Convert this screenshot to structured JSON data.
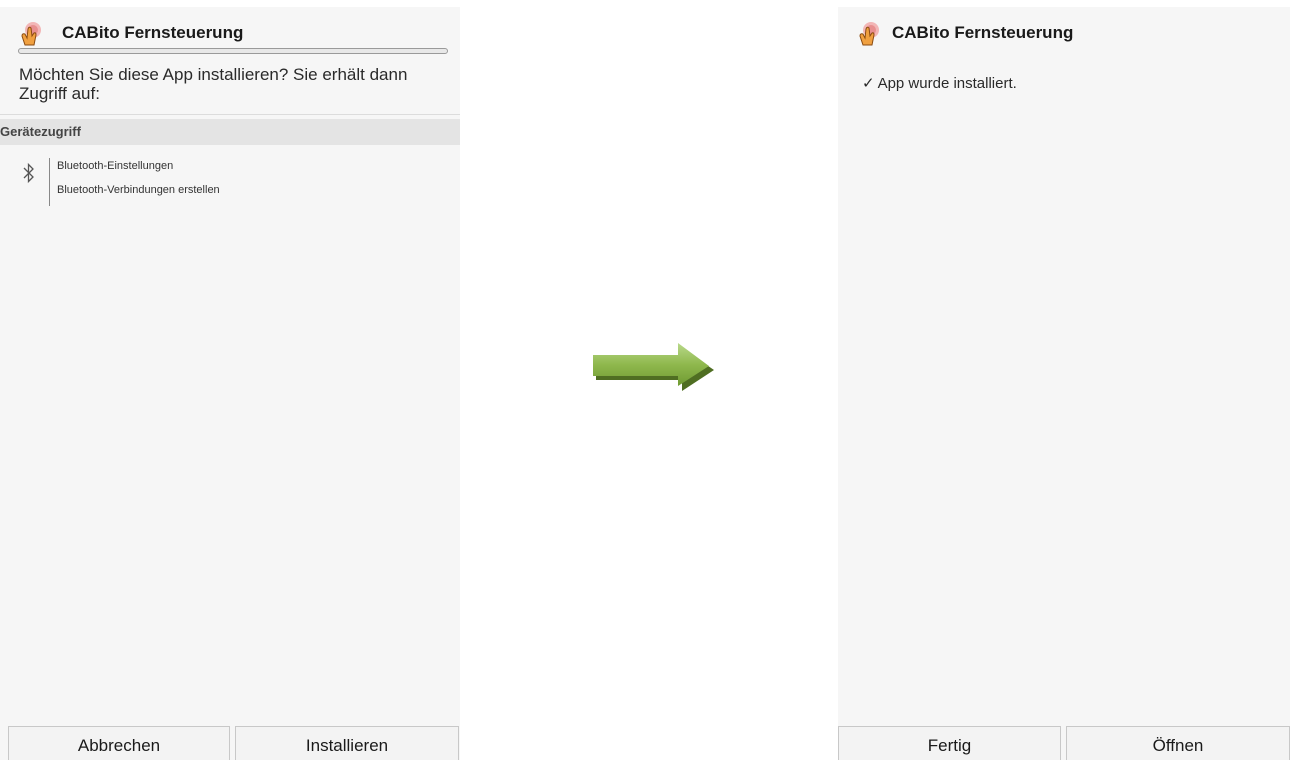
{
  "left_screen": {
    "app_title": "CABito Fernsteuerung",
    "question": "Möchten Sie diese App installieren? Sie erhält dann Zugriff auf:",
    "section_title": "Gerätezugriff",
    "permission_icon": "bluetooth-icon",
    "permissions": [
      "Bluetooth-Einstellungen",
      "Bluetooth-Verbindungen erstellen"
    ],
    "buttons": {
      "cancel": "Abbrechen",
      "install": "Installieren"
    }
  },
  "arrow": {
    "icon": "right-arrow-icon",
    "color": "#7fa83f"
  },
  "right_screen": {
    "app_title": "CABito Fernsteuerung",
    "status_icon": "checkmark-icon",
    "status": "App wurde installiert.",
    "buttons": {
      "done": "Fertig",
      "open": "Öffnen"
    }
  }
}
